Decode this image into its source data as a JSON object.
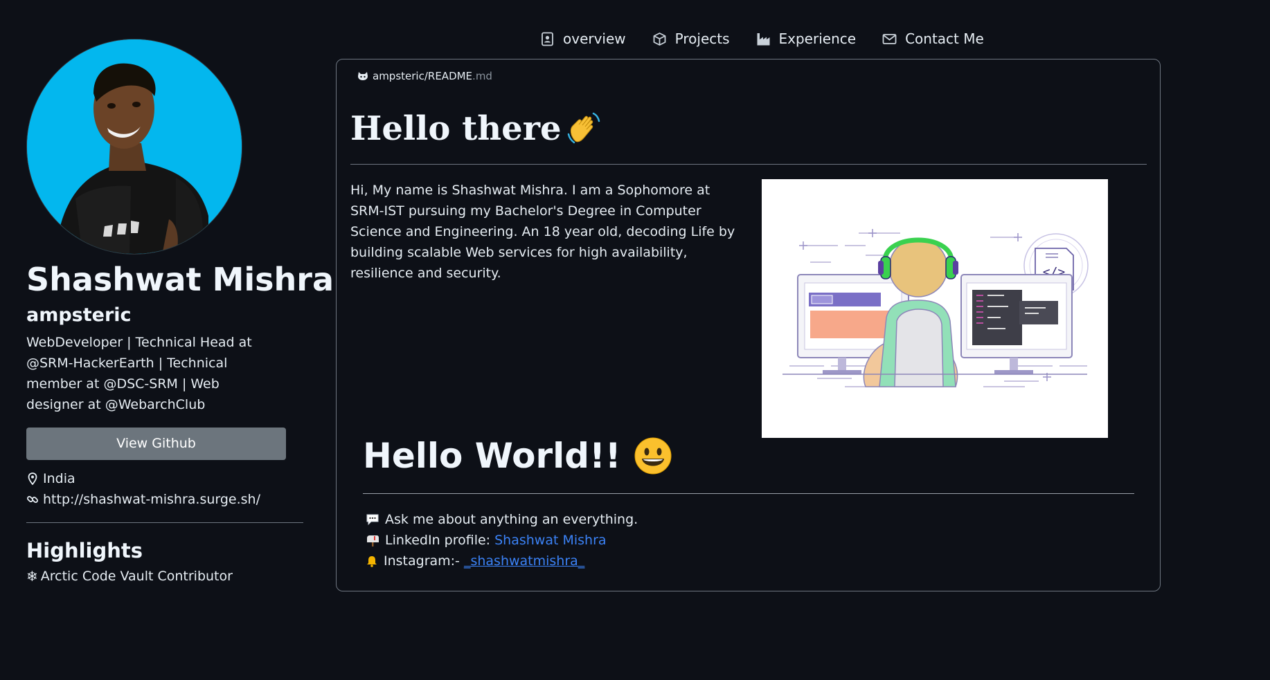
{
  "nav": {
    "items": [
      {
        "label": "overview",
        "icon": "contact-card-icon"
      },
      {
        "label": "Projects",
        "icon": "box-icon"
      },
      {
        "label": "Experience",
        "icon": "factory-icon"
      },
      {
        "label": "Contact Me",
        "icon": "envelope-icon"
      }
    ]
  },
  "profile": {
    "full_name": "Shashwat Mishra",
    "username": "ampsteric",
    "bio": "WebDeveloper | Technical Head at @SRM-HackerEarth | Technical member at @DSC-SRM | Web designer at @WebarchClub",
    "button_label": "View Github",
    "location": "India",
    "website": "http://shashwat-mishra.surge.sh/",
    "highlights_title": "Highlights",
    "highlight": "Arctic Code Vault Contributor"
  },
  "readme": {
    "owner": "ampsteric",
    "separator": "/",
    "file_name": "README",
    "file_ext": ".md",
    "hello_title": "Hello there",
    "hello_emoji": "wave-hand-emoji",
    "intro": "Hi, My name is Shashwat Mishra. I am a Sophomore at SRM-IST pursuing my Bachelor's Degree in Computer Science and Engineering. An 18 year old, decoding Life by building scalable Web services for high availability, resilience and security.",
    "hello_world": "Hello World!!",
    "hello_world_emoji": "grinning-face-emoji",
    "contact": {
      "ask": "Ask me about anything an everything.",
      "linkedin_prefix": "LinkedIn profile: ",
      "linkedin_link": "Shashwat Mishra",
      "instagram_prefix": "Instagram:- ",
      "instagram_link": "_shashwatmishra_"
    }
  },
  "colors": {
    "background": "#0d1017",
    "link": "#3b82f6",
    "button": "#6c757d",
    "avatar_bg": "#03b7ee"
  }
}
